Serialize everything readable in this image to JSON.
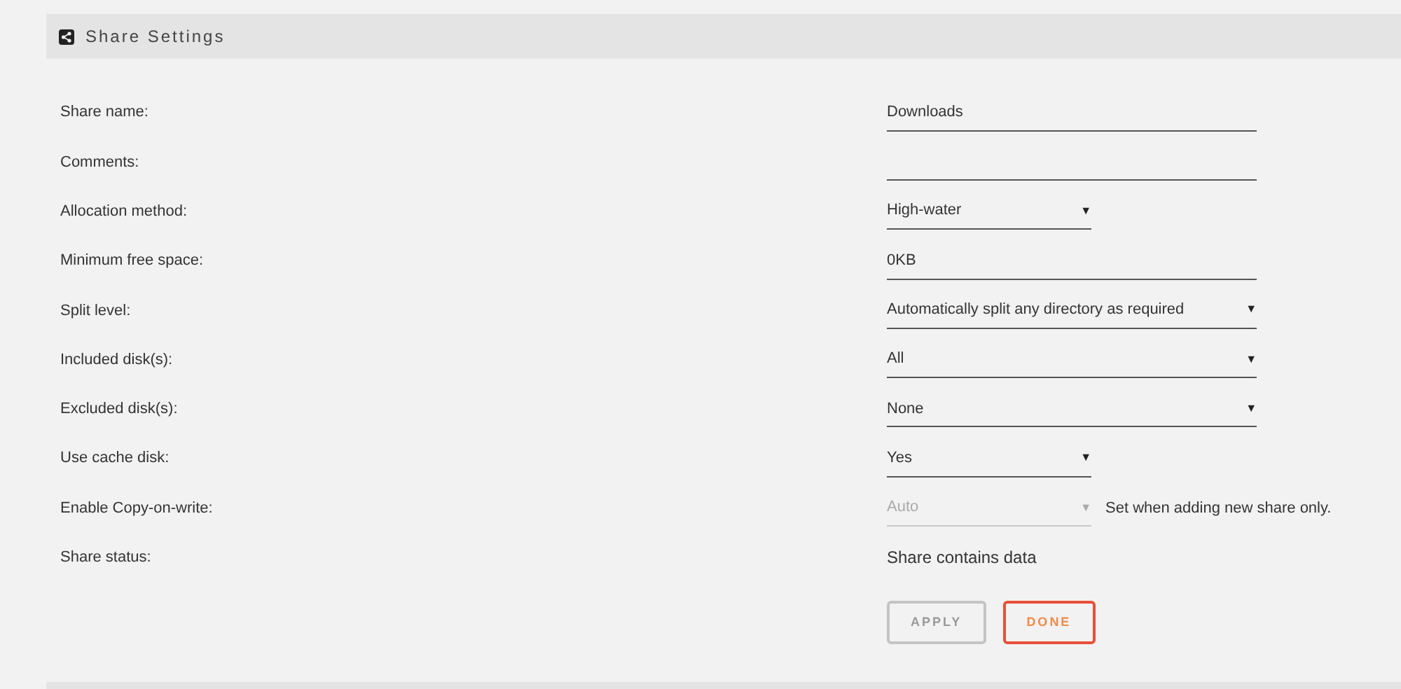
{
  "header": {
    "title": "Share Settings"
  },
  "rows": [
    {
      "label": "Share name:",
      "kind": "text",
      "value": "Downloads",
      "disabled": false
    },
    {
      "label": "Comments:",
      "kind": "text",
      "disabled": false
    },
    {
      "label": "Allocation method:",
      "kind": "short-select",
      "value": "High-water",
      "arrow": "▼",
      "disabled": false
    },
    {
      "label": "Minimum free space:",
      "kind": "text",
      "value": "0KB",
      "disabled": false
    },
    {
      "label": "Split level:",
      "kind": "select",
      "value": "Automatically split any directory as required",
      "arrow": "▼",
      "disabled": false
    },
    {
      "label": "Included disk(s):",
      "kind": "select",
      "value": "All",
      "arrow": "▼",
      "disabled": false
    },
    {
      "label": "Excluded disk(s):",
      "kind": "select",
      "value": "None",
      "arrow": "▼",
      "disabled": false
    },
    {
      "label": "Use cache disk:",
      "kind": "short-select",
      "value": "Yes",
      "arrow": "▼",
      "disabled": false
    },
    {
      "label": "Enable Copy-on-write:",
      "kind": "short-select",
      "value": "Auto",
      "arrow": "▼",
      "disabled": true,
      "note": "Set when adding new share only."
    },
    {
      "label": "Share status:",
      "kind": "static",
      "value": "Share contains data"
    }
  ],
  "buttons": [
    {
      "label": "APPLY",
      "disabled": true
    },
    {
      "label": "DONE",
      "disabled": false
    }
  ]
}
